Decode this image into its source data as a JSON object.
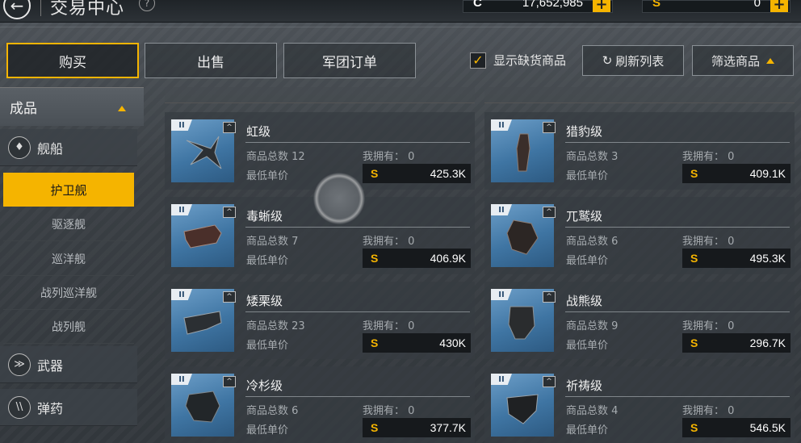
{
  "header": {
    "title": "交易中心",
    "help_glyph": "?",
    "back_glyph": "←"
  },
  "currency": {
    "credits_symbol": "C",
    "credits_value": "17,652,985",
    "special_symbol": "S",
    "special_value": "0",
    "plus_label": "+"
  },
  "tabs": {
    "buy": "购买",
    "sell": "出售",
    "legion_orders": "军团订单"
  },
  "toolbar": {
    "show_out_of_stock_label": "显示缺货商品",
    "show_out_of_stock_checked": true,
    "checkmark": "✓",
    "refresh_label": "刷新列表",
    "filter_label": "筛选商品"
  },
  "sidebar": {
    "category": "成品",
    "sections": [
      {
        "label": "舰船",
        "icon": "ship-icon",
        "glyph": "♦"
      },
      {
        "label": "武器",
        "icon": "weapon-icon",
        "glyph": "≫"
      },
      {
        "label": "弹药",
        "icon": "ammo-icon",
        "glyph": "\\\\"
      }
    ],
    "ship_types": [
      "护卫舰",
      "驱逐舰",
      "巡洋舰",
      "战列巡洋舰",
      "战列舰"
    ],
    "active_ship_type": "护卫舰"
  },
  "listing_labels": {
    "total_prefix": "商品总数",
    "own_prefix": "我拥有：",
    "min_price_label": "最低单价",
    "tier": "II",
    "caret": "^"
  },
  "items": [
    {
      "name": "虹级",
      "total": "12",
      "owned": "0",
      "price": "425.3K"
    },
    {
      "name": "猎豹级",
      "total": "3",
      "owned": "0",
      "price": "409.1K"
    },
    {
      "name": "毒蜥级",
      "total": "7",
      "owned": "0",
      "price": "406.9K"
    },
    {
      "name": "兀鹫级",
      "total": "6",
      "owned": "0",
      "price": "495.3K"
    },
    {
      "name": "矮栗级",
      "total": "23",
      "owned": "0",
      "price": "430K"
    },
    {
      "name": "战熊级",
      "total": "9",
      "owned": "0",
      "price": "296.7K"
    },
    {
      "name": "冷杉级",
      "total": "6",
      "owned": "0",
      "price": "377.7K"
    },
    {
      "name": "祈祷级",
      "total": "4",
      "owned": "0",
      "price": "546.5K"
    }
  ],
  "colors": {
    "accent": "#f5b400",
    "panel": "#373c41",
    "thumb_blue": "#4f86b5"
  }
}
